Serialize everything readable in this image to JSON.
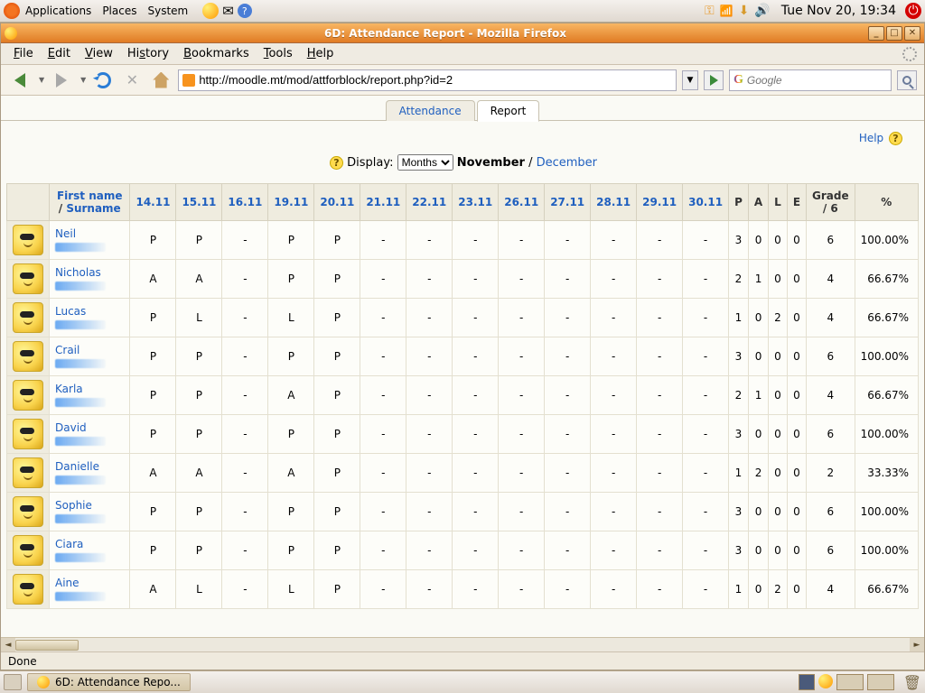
{
  "top_panel": {
    "menus": [
      "Applications",
      "Places",
      "System"
    ],
    "clock": "Tue Nov 20, 19:34"
  },
  "window": {
    "title": "6D: Attendance Report - Mozilla Firefox"
  },
  "menubar": [
    "File",
    "Edit",
    "View",
    "History",
    "Bookmarks",
    "Tools",
    "Help"
  ],
  "url": "http://moodle.mt/mod/attforblock/report.php?id=2",
  "search_placeholder": "Google",
  "page": {
    "tabs": {
      "attendance": "Attendance",
      "report": "Report"
    },
    "help": "Help",
    "display_label": "Display:",
    "display_select": "Months",
    "current_month": "November",
    "other_month": "December"
  },
  "columns": {
    "firstname": "First name",
    "surname": "Surname",
    "dates": [
      "14.11",
      "15.11",
      "16.11",
      "19.11",
      "20.11",
      "21.11",
      "22.11",
      "23.11",
      "26.11",
      "27.11",
      "28.11",
      "29.11",
      "30.11"
    ],
    "stats": [
      "P",
      "A",
      "L",
      "E"
    ],
    "grade": "Grade / 6",
    "pct": "%"
  },
  "rows": [
    {
      "first": "Neil",
      "marks": [
        "P",
        "P",
        "-",
        "P",
        "P",
        "-",
        "-",
        "-",
        "-",
        "-",
        "-",
        "-",
        "-"
      ],
      "p": 3,
      "a": 0,
      "l": 0,
      "e": 0,
      "grade": "6",
      "pct": "100.00%"
    },
    {
      "first": "Nicholas",
      "marks": [
        "A",
        "A",
        "-",
        "P",
        "P",
        "-",
        "-",
        "-",
        "-",
        "-",
        "-",
        "-",
        "-"
      ],
      "p": 2,
      "a": 1,
      "l": 0,
      "e": 0,
      "grade": "4",
      "pct": "66.67%"
    },
    {
      "first": "Lucas",
      "marks": [
        "P",
        "L",
        "-",
        "L",
        "P",
        "-",
        "-",
        "-",
        "-",
        "-",
        "-",
        "-",
        "-"
      ],
      "p": 1,
      "a": 0,
      "l": 2,
      "e": 0,
      "grade": "4",
      "pct": "66.67%"
    },
    {
      "first": "Crail",
      "marks": [
        "P",
        "P",
        "-",
        "P",
        "P",
        "-",
        "-",
        "-",
        "-",
        "-",
        "-",
        "-",
        "-"
      ],
      "p": 3,
      "a": 0,
      "l": 0,
      "e": 0,
      "grade": "6",
      "pct": "100.00%"
    },
    {
      "first": "Karla",
      "marks": [
        "P",
        "P",
        "-",
        "A",
        "P",
        "-",
        "-",
        "-",
        "-",
        "-",
        "-",
        "-",
        "-"
      ],
      "p": 2,
      "a": 1,
      "l": 0,
      "e": 0,
      "grade": "4",
      "pct": "66.67%"
    },
    {
      "first": "David",
      "marks": [
        "P",
        "P",
        "-",
        "P",
        "P",
        "-",
        "-",
        "-",
        "-",
        "-",
        "-",
        "-",
        "-"
      ],
      "p": 3,
      "a": 0,
      "l": 0,
      "e": 0,
      "grade": "6",
      "pct": "100.00%"
    },
    {
      "first": "Danielle",
      "marks": [
        "A",
        "A",
        "-",
        "A",
        "P",
        "-",
        "-",
        "-",
        "-",
        "-",
        "-",
        "-",
        "-"
      ],
      "p": 1,
      "a": 2,
      "l": 0,
      "e": 0,
      "grade": "2",
      "pct": "33.33%"
    },
    {
      "first": "Sophie",
      "marks": [
        "P",
        "P",
        "-",
        "P",
        "P",
        "-",
        "-",
        "-",
        "-",
        "-",
        "-",
        "-",
        "-"
      ],
      "p": 3,
      "a": 0,
      "l": 0,
      "e": 0,
      "grade": "6",
      "pct": "100.00%"
    },
    {
      "first": "Ciara",
      "marks": [
        "P",
        "P",
        "-",
        "P",
        "P",
        "-",
        "-",
        "-",
        "-",
        "-",
        "-",
        "-",
        "-"
      ],
      "p": 3,
      "a": 0,
      "l": 0,
      "e": 0,
      "grade": "6",
      "pct": "100.00%"
    },
    {
      "first": "Aine",
      "marks": [
        "A",
        "L",
        "-",
        "L",
        "P",
        "-",
        "-",
        "-",
        "-",
        "-",
        "-",
        "-",
        "-"
      ],
      "p": 1,
      "a": 0,
      "l": 2,
      "e": 0,
      "grade": "4",
      "pct": "66.67%"
    }
  ],
  "statusbar": "Done",
  "taskbar_label": "6D: Attendance Repo..."
}
